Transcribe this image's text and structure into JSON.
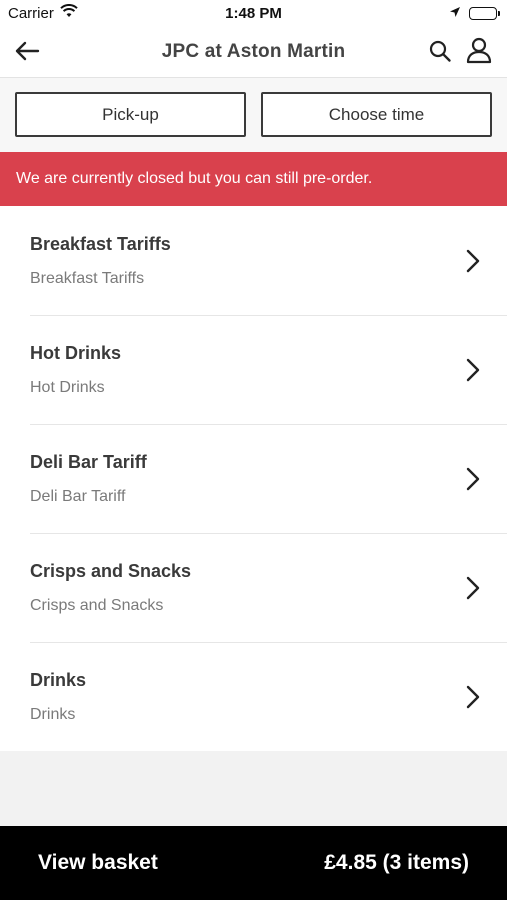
{
  "status_bar": {
    "carrier": "Carrier",
    "time": "1:48 PM",
    "icons": [
      "wifi-icon",
      "location-arrow-icon",
      "battery-icon"
    ]
  },
  "nav": {
    "title": "JPC at Aston Martin",
    "icons": [
      "back-arrow-icon",
      "search-icon",
      "user-icon"
    ]
  },
  "options": {
    "pickup_label": "Pick-up",
    "time_label": "Choose time"
  },
  "banner": {
    "text": "We are currently closed but you can still pre-order.",
    "color": "#d9414d"
  },
  "categories": [
    {
      "title": "Breakfast Tariffs",
      "subtitle": "Breakfast Tariffs"
    },
    {
      "title": "Hot Drinks",
      "subtitle": "Hot Drinks"
    },
    {
      "title": "Deli Bar Tariff",
      "subtitle": "Deli Bar Tariff"
    },
    {
      "title": "Crisps and Snacks",
      "subtitle": "Crisps and Snacks"
    },
    {
      "title": "Drinks",
      "subtitle": "Drinks"
    }
  ],
  "basket": {
    "label": "View basket",
    "summary": "£4.85 (3 items)"
  }
}
